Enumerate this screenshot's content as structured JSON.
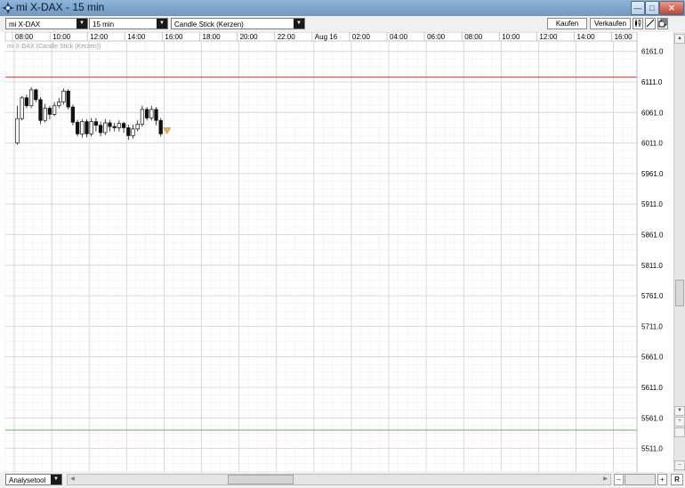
{
  "window": {
    "title": "mi X-DAX - 15 min"
  },
  "toolbar": {
    "instrument": "mi X-DAX",
    "interval": "15 min",
    "chart_type": "Candle Stick (Kerzen)",
    "buy_label": "Kaufen",
    "sell_label": "Verkaufen"
  },
  "chart": {
    "legend": "mi X-DAX (Candle Stick (Kerzen))",
    "time_labels": [
      "08:00",
      "10:00",
      "12:00",
      "14:00",
      "16:00",
      "18:00",
      "20:00",
      "22:00",
      "Aug 16",
      "02:00",
      "04:00",
      "06:00",
      "08:00",
      "10:00",
      "12:00",
      "14:00",
      "16:00"
    ],
    "price_labels": [
      "6161.0",
      "6111.0",
      "6061.0",
      "6011.0",
      "5961.0",
      "5911.0",
      "5861.0",
      "5811.0",
      "5761.0",
      "5711.0",
      "5661.0",
      "5611.0",
      "5561.0",
      "5511.0"
    ],
    "red_line_value": 6119,
    "green_line_value": 5541,
    "colors": {
      "red_line": "#d9534f",
      "green_line": "#5cb85c",
      "grid": "#dcdcdc",
      "candle": "#111111",
      "marker": "#f0ad4e"
    }
  },
  "bottom": {
    "tool_label": "Analysetool",
    "reset_label": "R"
  },
  "chart_data": {
    "type": "candlestick",
    "y_axis_range": [
      5490,
      6185
    ],
    "candles": [
      [
        6011,
        6051,
        6008,
        6072
      ],
      [
        6051,
        6085,
        6048,
        6088
      ],
      [
        6085,
        6072,
        6068,
        6090
      ],
      [
        6072,
        6098,
        6068,
        6102
      ],
      [
        6098,
        6082,
        6078,
        6100
      ],
      [
        6082,
        6048,
        6042,
        6086
      ],
      [
        6048,
        6068,
        6045,
        6075
      ],
      [
        6068,
        6058,
        6050,
        6072
      ],
      [
        6058,
        6072,
        6055,
        6078
      ],
      [
        6072,
        6078,
        6068,
        6085
      ],
      [
        6078,
        6096,
        6074,
        6100
      ],
      [
        6096,
        6070,
        6066,
        6099
      ],
      [
        6070,
        6045,
        6040,
        6074
      ],
      [
        6045,
        6026,
        6022,
        6049
      ],
      [
        6026,
        6046,
        6020,
        6050
      ],
      [
        6046,
        6026,
        6020,
        6050
      ],
      [
        6026,
        6046,
        6022,
        6052
      ],
      [
        6046,
        6040,
        6030,
        6052
      ],
      [
        6040,
        6028,
        6022,
        6046
      ],
      [
        6028,
        6044,
        6024,
        6050
      ],
      [
        6044,
        6038,
        6030,
        6048
      ],
      [
        6038,
        6036,
        6030,
        6044
      ],
      [
        6036,
        6043,
        6030,
        6048
      ],
      [
        6043,
        6036,
        6028,
        6046
      ],
      [
        6036,
        6023,
        6016,
        6041
      ],
      [
        6023,
        6034,
        6018,
        6041
      ],
      [
        6034,
        6042,
        6030,
        6048
      ],
      [
        6042,
        6066,
        6038,
        6072
      ],
      [
        6066,
        6052,
        6048,
        6070
      ],
      [
        6052,
        6066,
        6048,
        6072
      ],
      [
        6066,
        6048,
        6040,
        6070
      ],
      [
        6048,
        6026,
        6022,
        6052
      ]
    ]
  }
}
